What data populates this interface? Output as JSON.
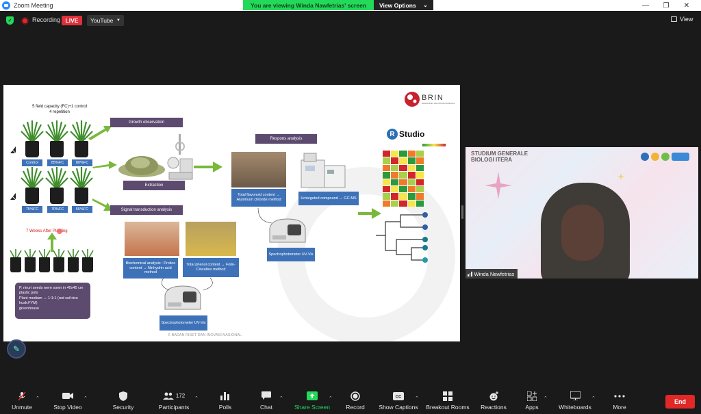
{
  "window": {
    "title": "Zoom Meeting"
  },
  "share_banner": {
    "message": "You are viewing Winda Nawfetrias' screen",
    "options_label": "View Options"
  },
  "status": {
    "recording_label": "Recording",
    "live_label": "LIVE",
    "stream_target": "YouTube",
    "view_label": "View"
  },
  "slide": {
    "header_line1": "5 field capacity (FC)+1 control",
    "header_line2": "4 repetition",
    "growth_observation": "Growth observation",
    "extraction": "Extraction",
    "signal_transduction": "Signal transduction analysis",
    "respons_analysis": "Respons analysis",
    "label_control": "Control",
    "label_85": "85%FC",
    "label_80": "80%FC",
    "label_75": "75%FC",
    "label_70": "70%FC",
    "label_55": "55%FC",
    "weeks_after": "7 Weeks After Planting",
    "notes": [
      "P. niruri seeds were sown in 40x40 cm plastic pots",
      "Plant medium → 1:1:1 (red soil:rice husk:FYM)",
      "greenhouse"
    ],
    "flavonoid_label": "Total flavonoid content → Aluminum chloride method",
    "untargeted_label": "Untargeted compound → GC-MS",
    "spectro_label_1": "Spectrophotometer UV-Vis",
    "biochem_label": "Biochemical analysis : Proline content → Ninhydrin acid method",
    "phenol_label": "Total phenol content → Folin-Ciocalteu method",
    "spectro_label_2": "Spectrophotometer UV-Vis",
    "brin_name": "BRIN",
    "brin_sub": "BADAN RISET DAN INOVASI NASIONAL",
    "rstudio": "Studio",
    "footer": "© BADAN RISET DAN INOVASI NASIONAL"
  },
  "video": {
    "banner_title_1": "STUDIUM GENERALE",
    "banner_title_2": "BIOLOGI ITERA",
    "participant_name": "Winda Nawfetrias"
  },
  "toolbar": {
    "mute": "Unmute",
    "video": "Stop Video",
    "security": "Security",
    "participants": "Participants",
    "participants_count": "172",
    "polls": "Polls",
    "chat": "Chat",
    "share": "Share Screen",
    "record": "Record",
    "captions": "Show Captions",
    "breakout": "Breakout Rooms",
    "reactions": "Reactions",
    "apps": "Apps",
    "whiteboards": "Whiteboards",
    "more": "More",
    "end": "End"
  },
  "colors": {
    "accent_green": "#23d959",
    "end_red": "#e02828",
    "slide_purple": "#5d4a6f",
    "slide_blue": "#3e72b8"
  }
}
